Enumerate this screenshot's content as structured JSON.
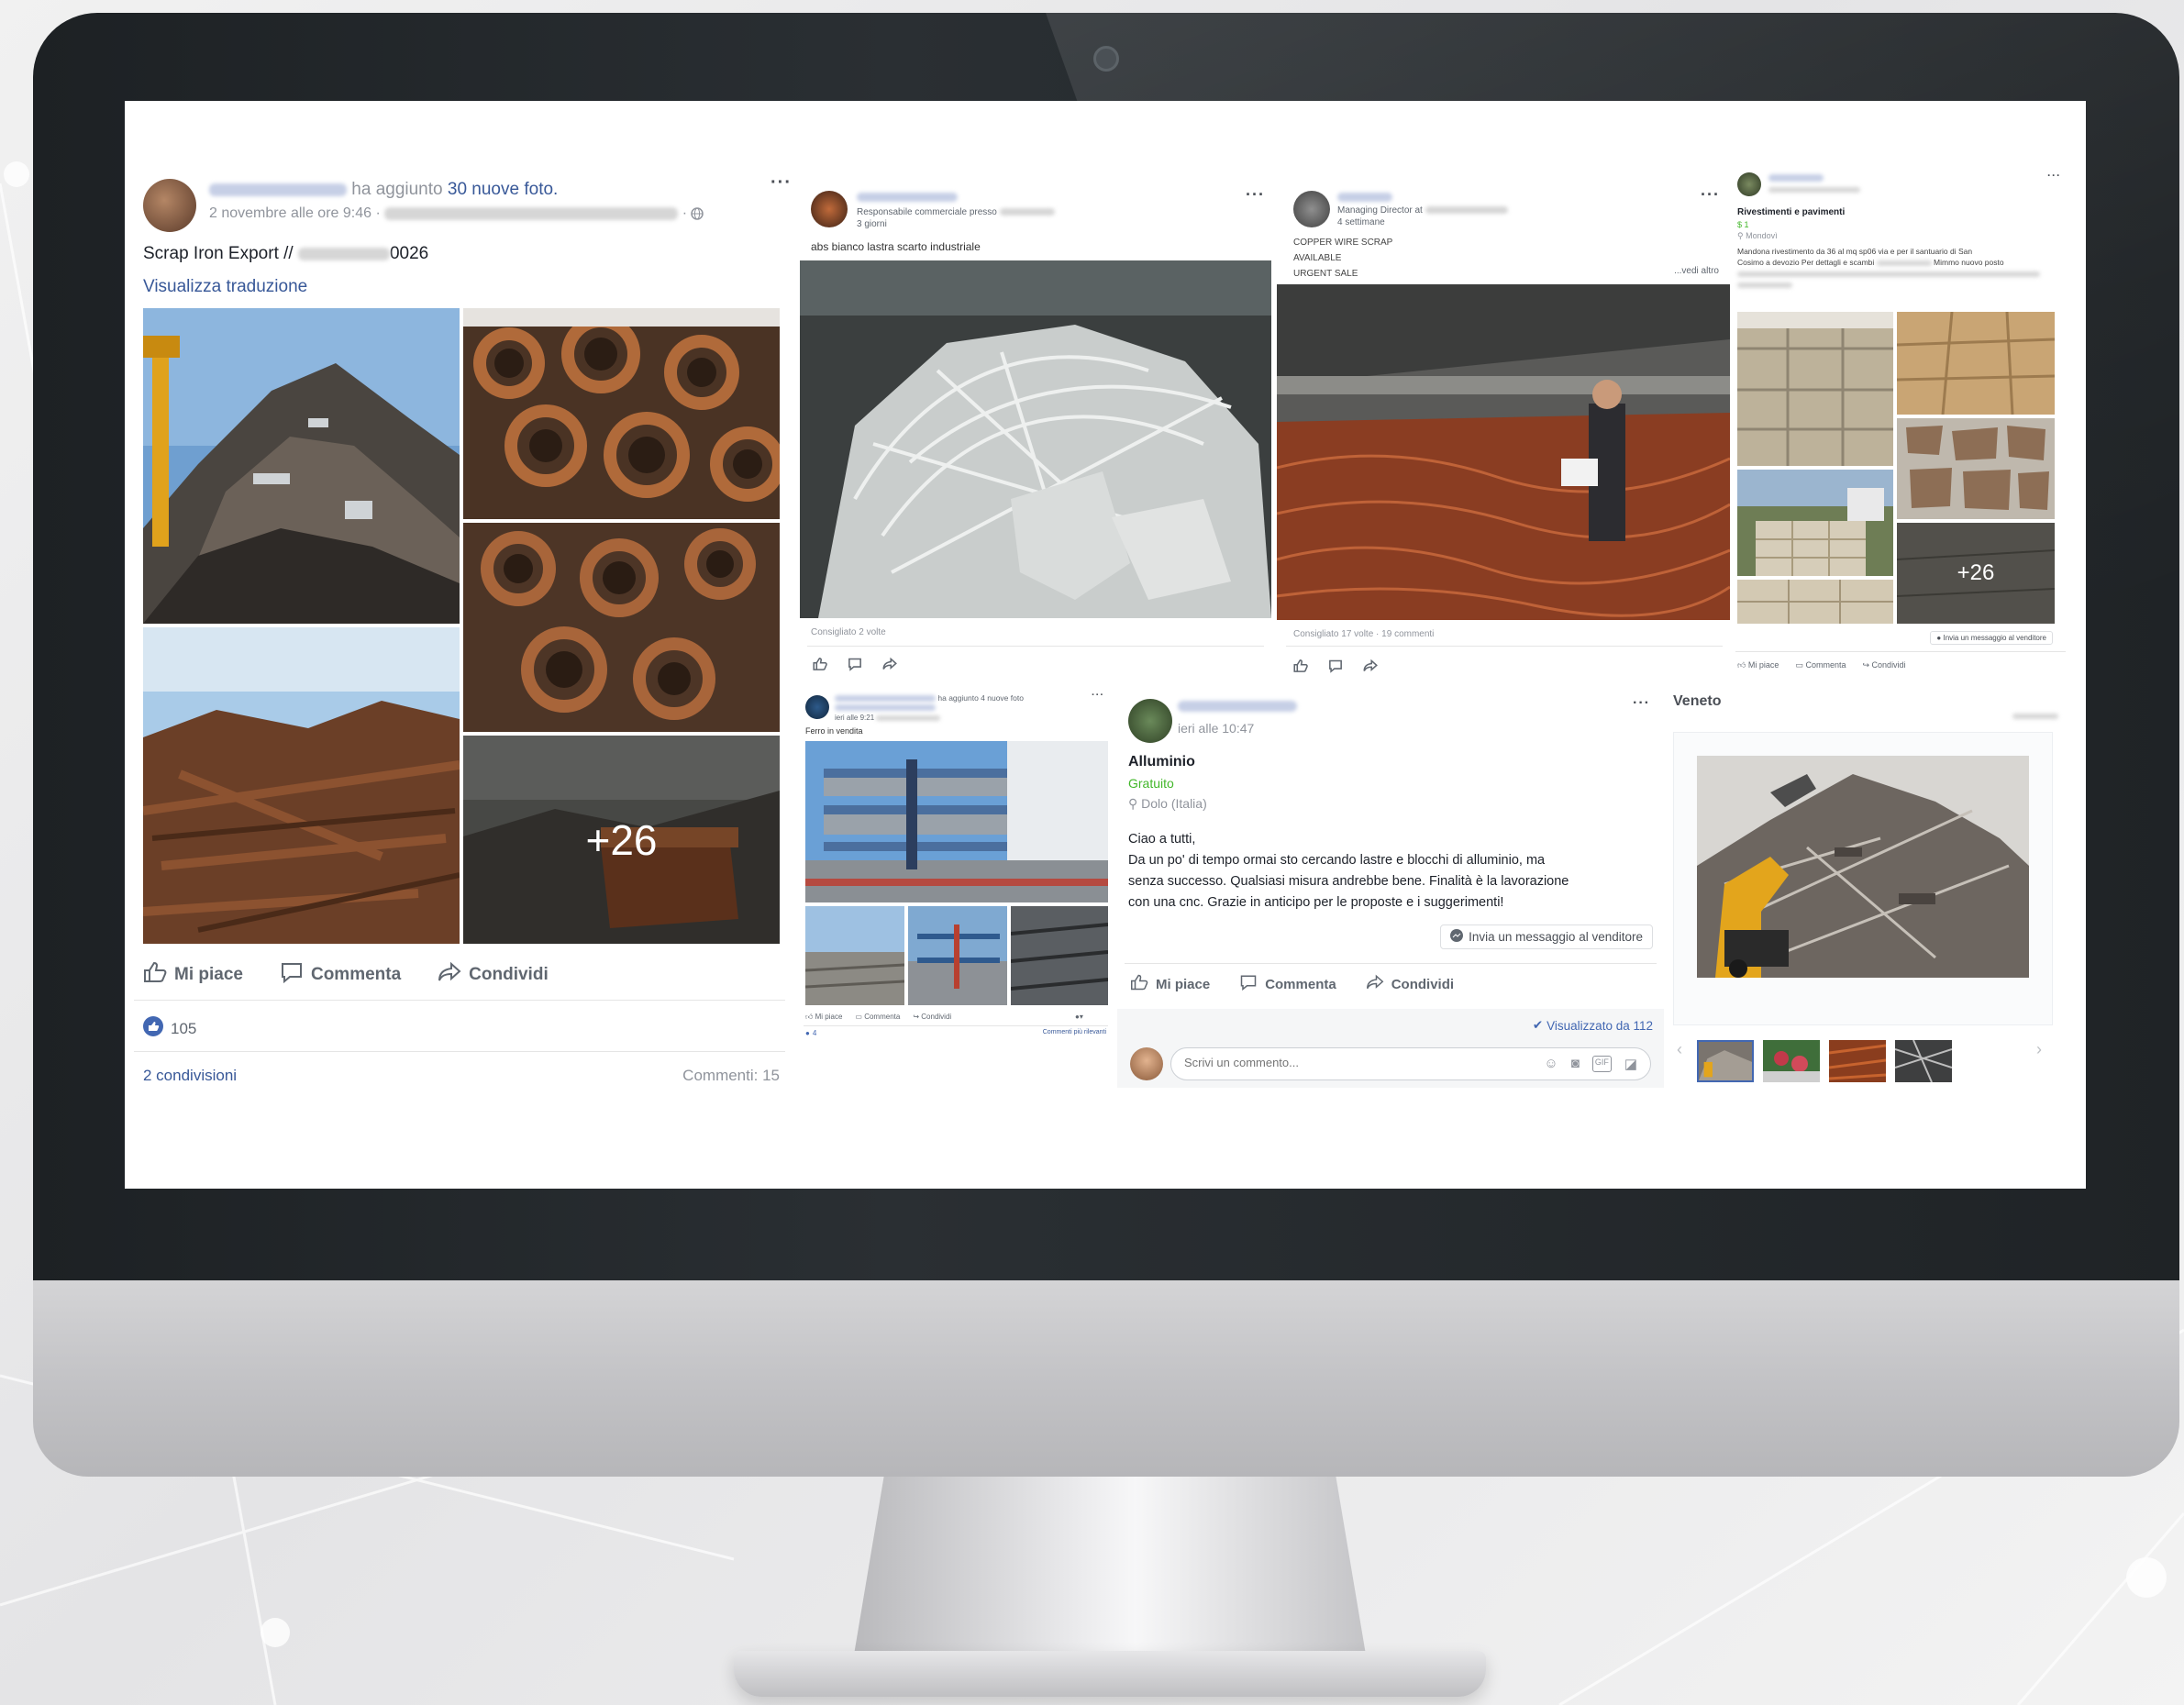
{
  "post1": {
    "action_text": "ha aggiunto",
    "action_count": "30 nuove foto.",
    "date": "2 novembre alle ore 9:46",
    "headline_prefix": "Scrap Iron Export //",
    "headline_suffix": "0026",
    "translate_link": "Visualizza traduzione",
    "more_photos": "+26",
    "like_label": "Mi piace",
    "comment_label": "Commenta",
    "share_label": "Condividi",
    "likes_count": "105",
    "shares": "2 condivisioni",
    "comments": "Commenti: 15"
  },
  "post2": {
    "role": "Responsabile commerciale presso",
    "time": "3 giorni",
    "text": "abs bianco lastra scarto industriale",
    "stats": "Consigliato 2 volte"
  },
  "post3": {
    "role": "Managing Director at",
    "time": "4 settimane",
    "line1": "COPPER WIRE SCRAP",
    "line2": "AVAILABLE",
    "line3": "URGENT SALE",
    "see_more": "...vedi altro",
    "stats": "Consigliato 17 volte · 19 commenti"
  },
  "post4": {
    "heading": "Rivestimenti e pavimenti",
    "price": "$ 1",
    "location": "Mondovì",
    "desc_start": "Mandona rivestimento da 36 al mq sp06 via e per il santuario di San",
    "desc_mid": "Cosimo a devozio Per dettagli e scambi",
    "desc_end": "Mimmo nuovo posto",
    "more_photos": "+26",
    "message_button": "Invia un messaggio al venditore",
    "like_label": "Mi piace",
    "comment_label": "Commenta",
    "share_label": "Condividi"
  },
  "post5": {
    "action": "ha aggiunto 4 nuove foto",
    "time": "ieri alle 9:21",
    "text": "Ferro in vendita",
    "like_label": "Mi piace",
    "comment_label": "Commenta",
    "share_label": "Condividi",
    "likes": "4",
    "more_comments": "Commenti più rilevanti"
  },
  "post6": {
    "time": "ieri alle 10:47",
    "title": "Alluminio",
    "price": "Gratuito",
    "location": "Dolo (Italia)",
    "greeting": "Ciao a tutti,",
    "body1": "Da un po' di tempo ormai sto cercando lastre e blocchi di alluminio, ma",
    "body2": "senza successo. Qualsiasi misura andrebbe bene. Finalità è la lavorazione",
    "body3": "con una cnc. Grazie in anticipo per le proposte e i suggerimenti!",
    "message_button": "Invia un messaggio al venditore",
    "like_label": "Mi piace",
    "comment_label": "Commenta",
    "share_label": "Condividi",
    "seen_by": "Visualizzato da 112",
    "comment_placeholder": "Scrivi un commento..."
  },
  "post7": {
    "region": "Veneto"
  },
  "colors": {
    "facebook_blue": "#385898",
    "like_blue": "#4267b2",
    "price_green": "#42b72a",
    "monitor_dark": "#1d2124"
  },
  "icons": [
    "like-icon",
    "comment-icon",
    "share-icon",
    "globe-icon",
    "location-pin-icon",
    "messenger-icon",
    "check-icon",
    "emoji-icon",
    "camera-icon",
    "gif-icon",
    "sticker-icon",
    "chevron-left-icon",
    "chevron-right-icon"
  ]
}
